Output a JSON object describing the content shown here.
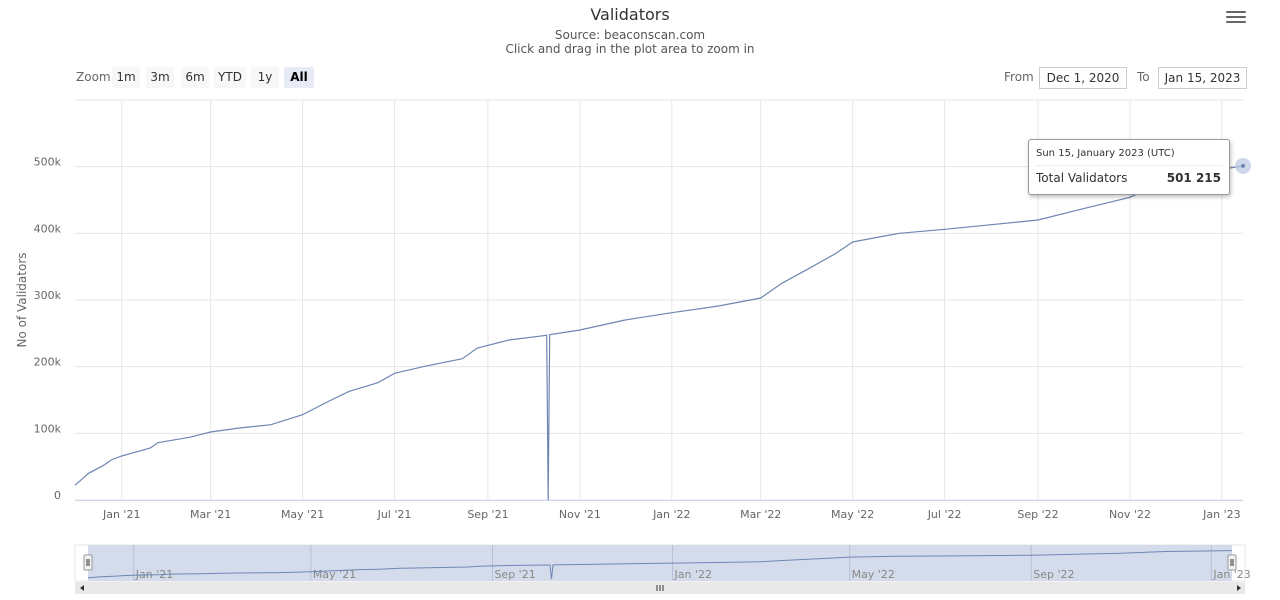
{
  "header": {
    "title": "Validators",
    "source": "Source: beaconscan.com",
    "hint": "Click and drag in the plot area to zoom in"
  },
  "toolbar": {
    "zoom_label": "Zoom",
    "zoom_buttons": [
      "1m",
      "3m",
      "6m",
      "YTD",
      "1y",
      "All"
    ],
    "selected_zoom": "All",
    "from_label": "From",
    "from_value": "Dec 1, 2020",
    "to_label": "To",
    "to_value": "Jan 15, 2023"
  },
  "tooltip": {
    "date": "Sun 15, January 2023 (UTC)",
    "series_name": "Total Validators",
    "value_text": "501 215"
  },
  "colors": {
    "line": "#6f86b4",
    "grid": "#e6e6e6",
    "navigator_mask": "#cfd8ea",
    "scrollbar": "#e9e9e9"
  },
  "chart_data": {
    "type": "line",
    "title": "Validators",
    "subtitle": "Source: beaconscan.com",
    "ylabel": "No of Validators",
    "xlabel": "",
    "xlim": [
      "2020-12-01",
      "2023-01-15"
    ],
    "ylim": [
      0,
      600000
    ],
    "yticks": [
      0,
      100000,
      200000,
      300000,
      400000,
      500000
    ],
    "ytick_labels": [
      "0",
      "100k",
      "200k",
      "300k",
      "400k",
      "500k"
    ],
    "xticks": [
      "2021-01-01",
      "2021-03-01",
      "2021-05-01",
      "2021-07-01",
      "2021-09-01",
      "2021-11-01",
      "2022-01-01",
      "2022-03-01",
      "2022-05-01",
      "2022-07-01",
      "2022-09-01",
      "2022-11-01",
      "2023-01-01"
    ],
    "xtick_labels": [
      "Jan '21",
      "Mar '21",
      "May '21",
      "Jul '21",
      "Sep '21",
      "Nov '21",
      "Jan '22",
      "Mar '22",
      "May '22",
      "Jul '22",
      "Sep '22",
      "Nov '22",
      "Jan '23"
    ],
    "navigator_xtick_labels": [
      "Jan '21",
      "May '21",
      "Sep '21",
      "Jan '22",
      "May '22",
      "Sep '22",
      "Jan '23"
    ],
    "grid": true,
    "legend": "none",
    "series": [
      {
        "name": "Total Validators",
        "points": [
          [
            "2020-12-01",
            22000
          ],
          [
            "2020-12-10",
            40000
          ],
          [
            "2020-12-20",
            52000
          ],
          [
            "2020-12-25",
            60000
          ],
          [
            "2021-01-01",
            66000
          ],
          [
            "2021-01-20",
            78000
          ],
          [
            "2021-01-25",
            86000
          ],
          [
            "2021-02-15",
            94000
          ],
          [
            "2021-03-01",
            102000
          ],
          [
            "2021-03-20",
            108000
          ],
          [
            "2021-04-10",
            113000
          ],
          [
            "2021-05-01",
            128000
          ],
          [
            "2021-05-20",
            150000
          ],
          [
            "2021-06-01",
            163000
          ],
          [
            "2021-06-20",
            176000
          ],
          [
            "2021-07-01",
            190000
          ],
          [
            "2021-07-20",
            200000
          ],
          [
            "2021-08-15",
            212000
          ],
          [
            "2021-08-25",
            228000
          ],
          [
            "2021-09-15",
            240000
          ],
          [
            "2021-10-10",
            247000
          ],
          [
            "2021-10-11",
            0
          ],
          [
            "2021-10-12",
            248000
          ],
          [
            "2021-11-01",
            255000
          ],
          [
            "2021-12-01",
            270000
          ],
          [
            "2022-01-01",
            281000
          ],
          [
            "2022-02-01",
            291000
          ],
          [
            "2022-03-01",
            303000
          ],
          [
            "2022-03-15",
            325000
          ],
          [
            "2022-04-01",
            346000
          ],
          [
            "2022-04-20",
            370000
          ],
          [
            "2022-05-01",
            387000
          ],
          [
            "2022-05-15",
            393000
          ],
          [
            "2022-06-01",
            400000
          ],
          [
            "2022-07-01",
            406000
          ],
          [
            "2022-08-01",
            413000
          ],
          [
            "2022-09-01",
            420000
          ],
          [
            "2022-10-01",
            437000
          ],
          [
            "2022-11-01",
            454000
          ],
          [
            "2022-12-01",
            485000
          ],
          [
            "2023-01-15",
            501215
          ]
        ]
      }
    ]
  }
}
